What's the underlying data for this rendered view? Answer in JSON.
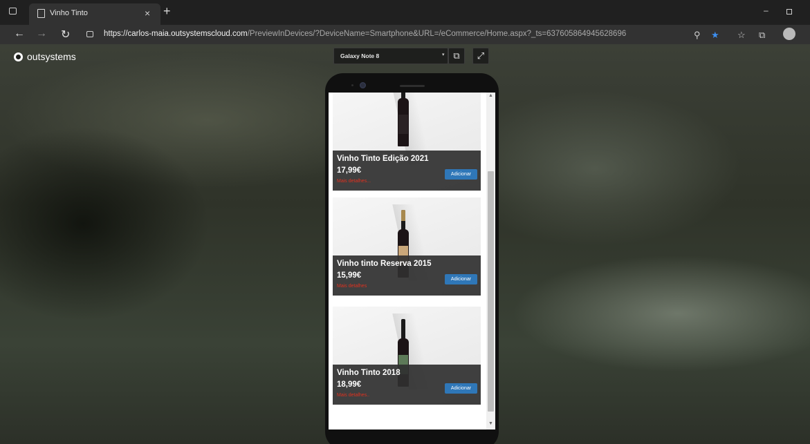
{
  "browser": {
    "tab_title": "Vinho Tinto",
    "tab_close": "×",
    "new_tab": "+",
    "window_minimize": "–",
    "url_host": "https://carlos-maia.outsystemscloud.com",
    "url_path": "/PreviewInDevices/?DeviceName=Smartphone&URL=/eCommerce/Home.aspx?_ts=637605864945628696",
    "icons": [
      "sidebar-icon",
      "page-icon",
      "back-icon",
      "forward-icon",
      "reload-icon",
      "lock-icon",
      "zoom-icon",
      "favorite-star-icon",
      "favorites-icon",
      "collections-icon",
      "profile-icon"
    ],
    "accent_color": "#3d8ff0"
  },
  "preview": {
    "brand": "outsystems",
    "device_name": "Galaxy Note 8",
    "caret": "▾",
    "rotate_glyph": "⧉",
    "fullscreen_glyph": "⤢"
  },
  "products": [
    {
      "name": "Vinho Tinto Edição 2021",
      "price": "17,99€",
      "details_link": "Mais detalhes...",
      "add_label": "Adicionar"
    },
    {
      "name": "Vinho tinto Reserva 2015",
      "price": "15,99€",
      "details_link": "Mais detalhes",
      "add_label": "Adicionar"
    },
    {
      "name": "Vinho Tinto 2018",
      "price": "18,99€",
      "details_link": "Mais detalhes..",
      "add_label": "Adicionar"
    }
  ],
  "colors": {
    "add_button": "#2f77b8",
    "details_link": "#e0311f"
  }
}
